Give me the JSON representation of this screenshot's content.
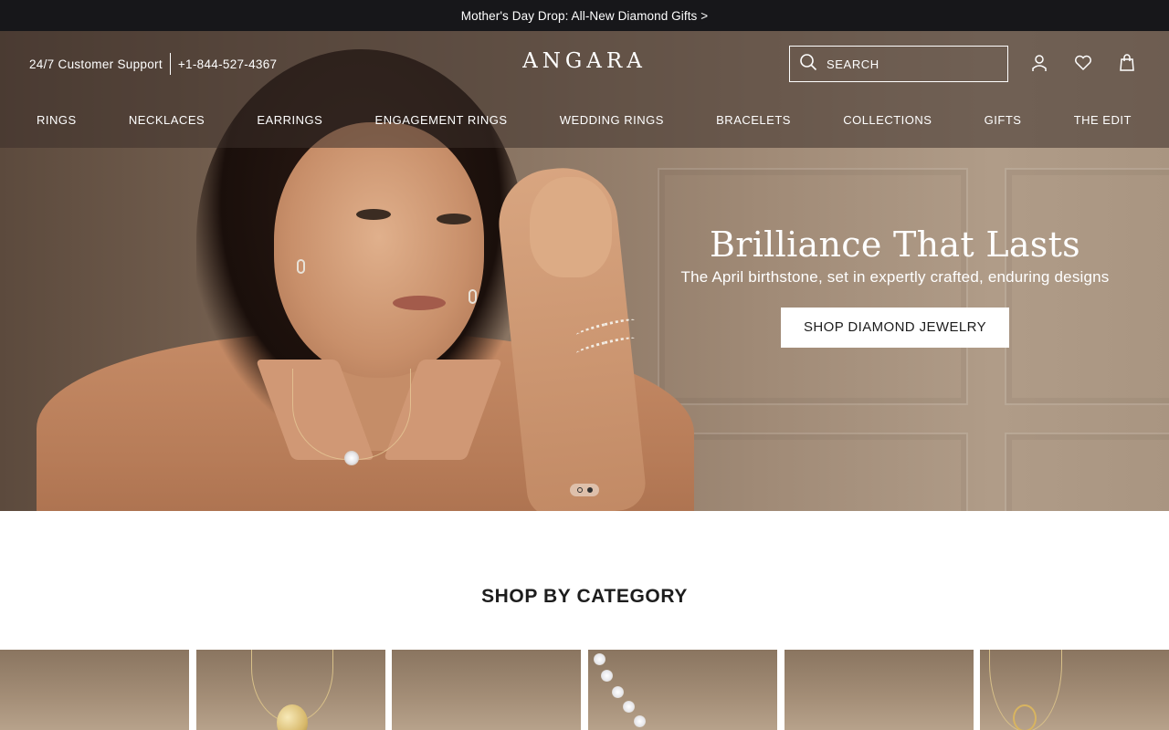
{
  "announcement": {
    "text": "Mother's Day Drop: All-New Diamond Gifts >"
  },
  "header": {
    "support_label": "24/7 Customer Support",
    "phone": "+1-844-527-4367",
    "logo": "ANGARA",
    "search": {
      "placeholder": "SEARCH",
      "value": ""
    },
    "icons": [
      "user-icon",
      "heart-icon",
      "bag-icon"
    ]
  },
  "nav": {
    "items": [
      {
        "label": "RINGS"
      },
      {
        "label": "NECKLACES"
      },
      {
        "label": "EARRINGS"
      },
      {
        "label": "ENGAGEMENT RINGS"
      },
      {
        "label": "WEDDING RINGS"
      },
      {
        "label": "BRACELETS"
      },
      {
        "label": "COLLECTIONS"
      },
      {
        "label": "GIFTS"
      },
      {
        "label": "THE EDIT"
      }
    ]
  },
  "hero": {
    "title": "Brilliance That Lasts",
    "subtitle": "The April birthstone, set in expertly crafted, enduring designs",
    "cta_label": "SHOP DIAMOND JEWELRY",
    "slide_count": 2,
    "active_slide": 2
  },
  "categories": {
    "title": "SHOP BY CATEGORY",
    "tile_count": 6
  },
  "colors": {
    "announcement_bg": "#17171a",
    "header_overlay": "rgba(60,48,42,0.55)",
    "text_dark": "#1d1d1d",
    "white": "#ffffff"
  }
}
